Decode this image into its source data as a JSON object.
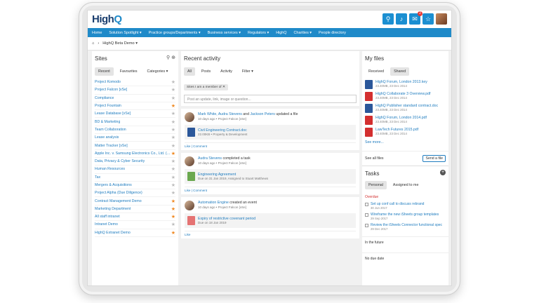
{
  "app": {
    "logo_main": "High",
    "logo_q": "Q",
    "notif_count": "2"
  },
  "nav": [
    "Home",
    "Solution Spotlight ▾",
    "Practice groups/Departments ▾",
    "Business services ▾",
    "Regulators ▾",
    "HighQ",
    "Charities ▾",
    "People directory"
  ],
  "crumb": {
    "label": "HighQ Beta Demo ▾"
  },
  "sites": {
    "title": "Sites",
    "tabs": [
      "Recent",
      "Favourites",
      "Categories ▾"
    ],
    "items": [
      {
        "label": "Project Komodo",
        "fav": false
      },
      {
        "label": "Project Falcon [vSe]",
        "fav": false
      },
      {
        "label": "Compliance",
        "fav": false
      },
      {
        "label": "Project Fountain",
        "fav": true
      },
      {
        "label": "Lease Database [vSe]",
        "fav": false
      },
      {
        "label": "BD & Marketing",
        "fav": false
      },
      {
        "label": "Team Collaboration",
        "fav": false
      },
      {
        "label": "Lease analysis",
        "fav": false
      },
      {
        "label": "Matter Tracker [vSe]",
        "fav": false
      },
      {
        "label": "Apple Inc. v. Samsung Electronics Co., Ltd. (1...",
        "fav": true
      },
      {
        "label": "Data, Privacy & Cyber Security",
        "fav": false
      },
      {
        "label": "Human Resources",
        "fav": false
      },
      {
        "label": "Tax",
        "fav": false
      },
      {
        "label": "Mergers & Acquisitions",
        "fav": false
      },
      {
        "label": "Project Alpha (Due Diligence)",
        "fav": false
      },
      {
        "label": "Contract Management Demo",
        "fav": true
      },
      {
        "label": "Marketing Department",
        "fav": true
      },
      {
        "label": "All staff intranet",
        "fav": true
      },
      {
        "label": "Intranet Demo",
        "fav": false
      },
      {
        "label": "HighQ Extranet Demo",
        "fav": true
      }
    ]
  },
  "activity": {
    "title": "Recent activity",
    "tabs": [
      "All",
      "Posts",
      "Activity",
      "Filter ▾"
    ],
    "filter_chip": "Sites I am a member of ✕",
    "post_placeholder": "Post an update, link, image or question...",
    "cards": [
      {
        "who": "Mark White, Audra Stevens",
        "and": " and ",
        "who2": "Jackson Peters",
        "action": " updated a file",
        "meta": "10 days ago • Project Falcon [vSe]",
        "attach": "Civil Engineering Contract.doc",
        "attach_meta": "22.00KB • Property & Development",
        "links": "Like | Comment"
      },
      {
        "who": "Audra Stevens",
        "and": "",
        "who2": "",
        "action": " completed a task",
        "meta": "10 days ago • Project Falcon [vSe]",
        "attach": "Engineering Agreement",
        "attach_meta": "Due on 31 Jan 2019, Assigned to Stuart Matthews",
        "links": "Like | Comment"
      },
      {
        "who": "Automation Engine",
        "and": "",
        "who2": "",
        "action": " created an event",
        "meta": "10 days ago • Project Falcon [vSe]",
        "attach": "Expiry of restrictive covenant period",
        "attach_meta": "Due on 18 Jan 2019",
        "links": "Like"
      }
    ]
  },
  "files": {
    "title": "My files",
    "tabs": [
      "Received",
      "Shared"
    ],
    "items": [
      {
        "name": "HighQ Forum, London 2013.key",
        "meta": "23.40MB, 23 Dec 2014",
        "kind": "word"
      },
      {
        "name": "HighQ Collaborate 3 Overview.pdf",
        "meta": "23.40MB, 23 Dec 2014",
        "kind": "pdf"
      },
      {
        "name": "HighQ Publisher standard contract.doc",
        "meta": "23.40MB, 23 Dec 2014",
        "kind": "word"
      },
      {
        "name": "HighQ Forum, London 2014.pdf",
        "meta": "23.40MB, 23 Dec 2014",
        "kind": "pdf"
      },
      {
        "name": "LawTech Futures 2015.pdf",
        "meta": "23.40MB, 23 Dec 2014",
        "kind": "pdf"
      }
    ],
    "see_more": "See more...",
    "see_all": "See all files",
    "send_label": "Send a file"
  },
  "tasks": {
    "title": "Tasks",
    "tabs": [
      "Personal",
      "Assigned to me"
    ],
    "overdue_label": "Overdue",
    "items": [
      {
        "name": "Set up conf call to discuss rebrand",
        "date": "30 Jun 2017"
      },
      {
        "name": "Wireframe the new iSheets group templates",
        "date": "29 Sep 2017"
      },
      {
        "name": "Review the iSheets Connector functional spec",
        "date": "29 Dec 2017"
      }
    ],
    "future_label": "In the future",
    "nodue_label": "No due date"
  }
}
